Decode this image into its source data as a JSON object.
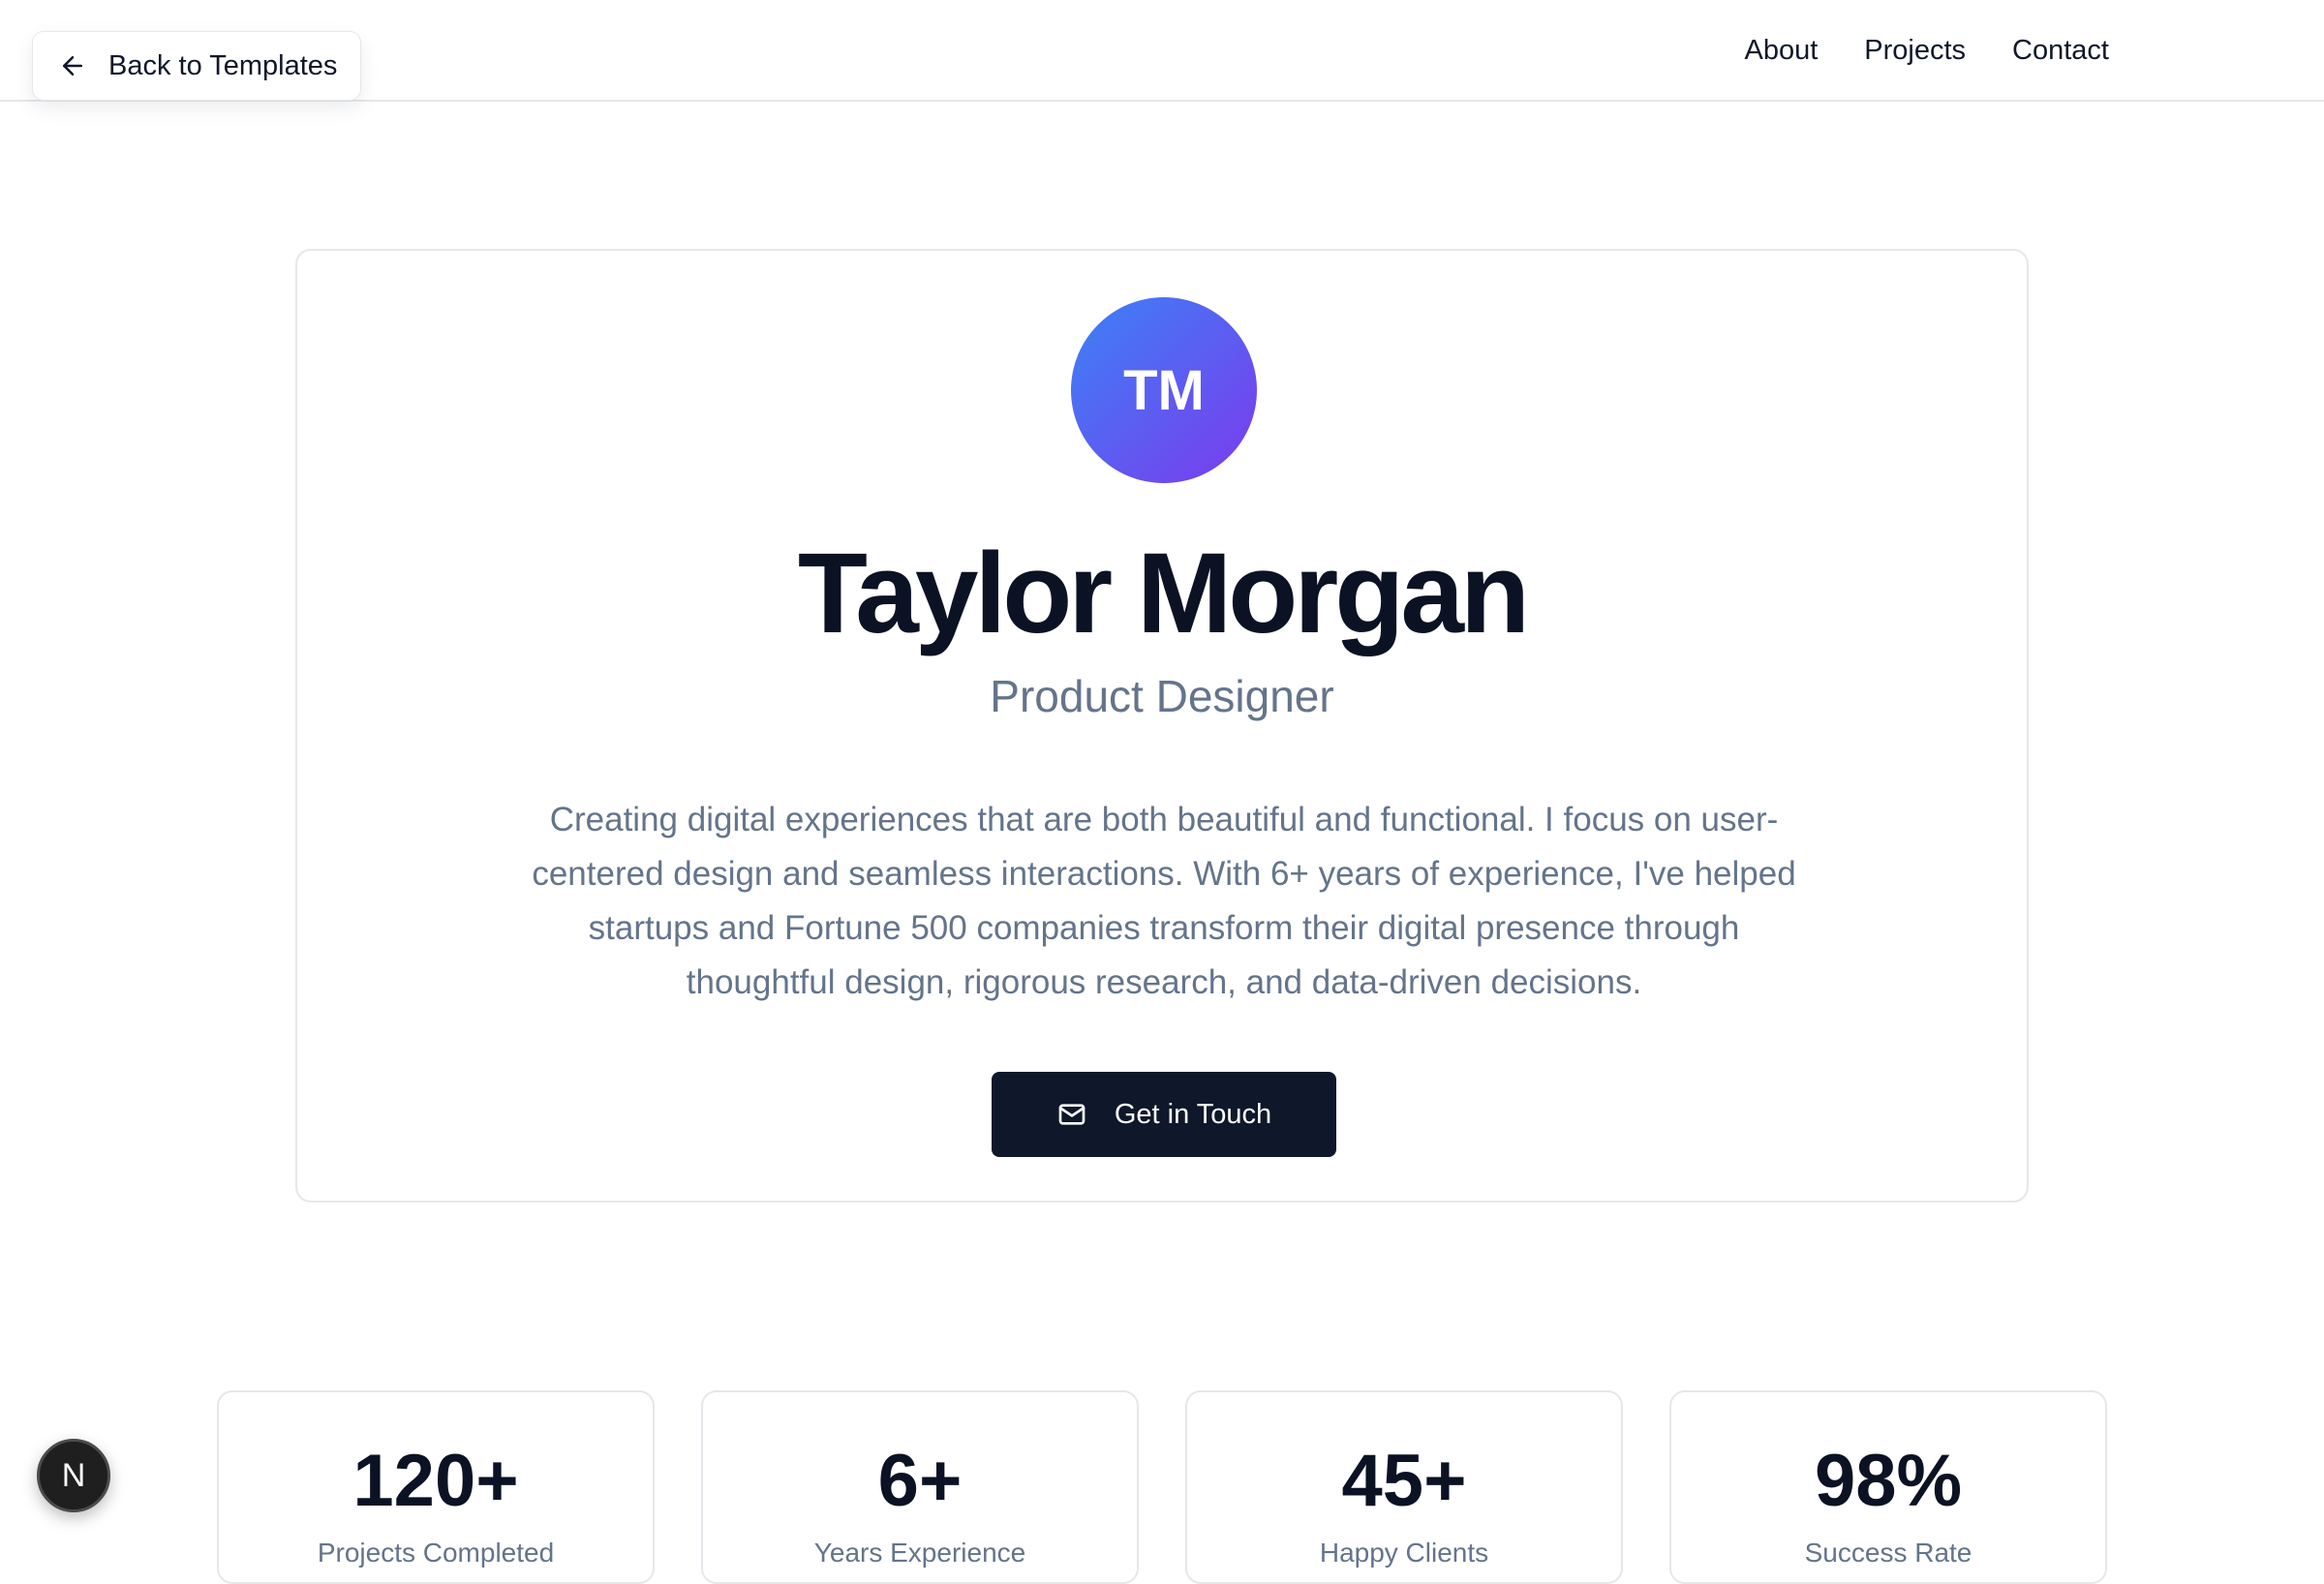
{
  "header": {
    "back_label": "Back to Templates",
    "nav": [
      "About",
      "Projects",
      "Contact"
    ]
  },
  "hero": {
    "initials": "TM",
    "name": "Taylor Morgan",
    "role": "Product Designer",
    "bio": "Creating digital experiences that are both beautiful and functional. I focus on user-centered design and seamless interactions. With 6+ years of experience, I've helped startups and Fortune 500 companies transform their digital presence through thoughtful design, rigorous research, and data-driven decisions.",
    "cta_label": "Get in Touch"
  },
  "stats": [
    {
      "value": "120+",
      "label": "Projects Completed"
    },
    {
      "value": "6+",
      "label": "Years Experience"
    },
    {
      "value": "45+",
      "label": "Happy Clients"
    },
    {
      "value": "98%",
      "label": "Success Rate"
    }
  ],
  "badge": {
    "letter": "N"
  },
  "colors": {
    "accent_dark": "#0f172a",
    "avatar_gradient_start": "#3b82f6",
    "avatar_gradient_end": "#7c3aed",
    "muted_text": "#64748b"
  },
  "icons": {
    "back": "arrow-left-icon",
    "cta": "mail-icon"
  }
}
